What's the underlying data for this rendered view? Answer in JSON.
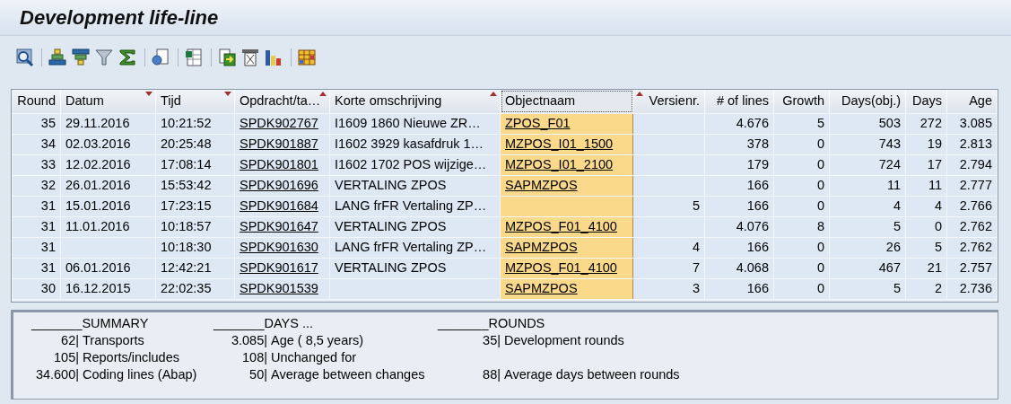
{
  "window": {
    "title": "Development life-line"
  },
  "table": {
    "columns": [
      {
        "label": "Round",
        "numeric": true,
        "sort_down": false,
        "sort_up": false,
        "selected": false
      },
      {
        "label": "Datum",
        "numeric": false,
        "sort_down": true,
        "sort_up": false,
        "selected": false
      },
      {
        "label": "Tijd",
        "numeric": false,
        "sort_down": true,
        "sort_up": false,
        "selected": false
      },
      {
        "label": "Opdracht/ta…",
        "numeric": false,
        "sort_down": false,
        "sort_up": true,
        "selected": false
      },
      {
        "label": "Korte omschrijving",
        "numeric": false,
        "sort_down": false,
        "sort_up": true,
        "selected": false
      },
      {
        "label": "Objectnaam",
        "numeric": false,
        "sort_down": false,
        "sort_up": false,
        "selected": true
      },
      {
        "label": "Versienr.",
        "numeric": true,
        "sort_down": false,
        "sort_up": true,
        "selected": false
      },
      {
        "label": "# of lines",
        "numeric": true,
        "sort_down": false,
        "sort_up": false,
        "selected": false
      },
      {
        "label": "Growth",
        "numeric": true,
        "sort_down": false,
        "sort_up": false,
        "selected": false
      },
      {
        "label": "Days(obj.)",
        "numeric": true,
        "sort_down": false,
        "sort_up": false,
        "selected": false
      },
      {
        "label": "Days",
        "numeric": true,
        "sort_down": false,
        "sort_up": false,
        "selected": false
      },
      {
        "label": "Age",
        "numeric": true,
        "sort_down": false,
        "sort_up": false,
        "selected": false
      }
    ],
    "rows": [
      {
        "round": "35",
        "datum": "29.11.2016",
        "tijd": "10:21:52",
        "opdracht": "SPDK902767",
        "omschrijving": "I1609 1860 Nieuwe ZR…",
        "objectnaam": "ZPOS_F01",
        "lines": "4.676",
        "growth": "5",
        "days_obj": "503",
        "days": "272",
        "age": "3.085"
      },
      {
        "round": "34",
        "datum": "02.03.2016",
        "tijd": "20:25:48",
        "opdracht": "SPDK901887",
        "omschrijving": "I1602 3929 kasafdruk 1…",
        "objectnaam": "MZPOS_I01_1500",
        "lines": "378",
        "growth": "0",
        "days_obj": "743",
        "days": "19",
        "age": "2.813"
      },
      {
        "round": "33",
        "datum": "12.02.2016",
        "tijd": "17:08:14",
        "opdracht": "SPDK901801",
        "omschrijving": "I1602 1702 POS wijzige…",
        "objectnaam": "MZPOS_I01_2100",
        "lines": "179",
        "growth": "0",
        "days_obj": "724",
        "days": "17",
        "age": "2.794"
      },
      {
        "round": "32",
        "datum": "26.01.2016",
        "tijd": "15:53:42",
        "opdracht": "SPDK901696",
        "omschrijving": "VERTALING ZPOS",
        "objectnaam": "SAPMZPOS",
        "lines": "166",
        "growth": "0",
        "days_obj": "11",
        "days": "11",
        "age": "2.777"
      },
      {
        "round": "31",
        "datum": "15.01.2016",
        "tijd": "17:23:15",
        "opdracht": "SPDK901684",
        "omschrijving": "LANG frFR Vertaling ZP…",
        "versienr": "5",
        "lines": "166",
        "growth": "0",
        "days_obj": "4",
        "days": "4",
        "age": "2.766"
      },
      {
        "round": "31",
        "datum": "11.01.2016",
        "tijd": "10:18:57",
        "opdracht": "SPDK901647",
        "omschrijving": "VERTALING ZPOS",
        "objectnaam": "MZPOS_F01_4100",
        "lines": "4.076",
        "growth": "8",
        "days_obj": "5",
        "days": "0",
        "age": "2.762"
      },
      {
        "round": "31",
        "tijd": "10:18:30",
        "opdracht": "SPDK901630",
        "omschrijving": "LANG frFR Vertaling ZP…",
        "objectnaam": "SAPMZPOS",
        "versienr": "4",
        "lines": "166",
        "growth": "0",
        "days_obj": "26",
        "days": "5",
        "age": "2.762"
      },
      {
        "round": "31",
        "datum": "06.01.2016",
        "tijd": "12:42:21",
        "opdracht": "SPDK901617",
        "omschrijving": "VERTALING ZPOS",
        "objectnaam": "MZPOS_F01_4100",
        "versienr": "7",
        "lines": "4.068",
        "growth": "0",
        "days_obj": "467",
        "days": "21",
        "age": "2.757"
      },
      {
        "round": "30",
        "datum": "16.12.2015",
        "tijd": "22:02:35",
        "opdracht": "SPDK901539",
        "objectnaam": "SAPMZPOS",
        "versienr": "3",
        "lines": "166",
        "growth": "0",
        "days_obj": "5",
        "days": "2",
        "age": "2.736"
      }
    ]
  },
  "summary": {
    "sections": [
      {
        "heading": "_______SUMMARY",
        "items": [
          {
            "amount": "62|",
            "caption": "Transports"
          },
          {
            "amount": "105|",
            "caption": "Reports/includes"
          },
          {
            "amount": "34.600|",
            "caption": "Coding lines (Abap)"
          }
        ]
      },
      {
        "heading": "_______DAYS ...",
        "items": [
          {
            "amount": "3.085|",
            "caption": "Age ( 8,5 years)"
          },
          {
            "amount": "108|",
            "caption": "Unchanged for"
          },
          {
            "amount": "50|",
            "caption": "Average between changes"
          }
        ]
      },
      {
        "heading": "_______ROUNDS",
        "items": [
          {
            "amount": "35|",
            "caption": "Development rounds"
          },
          {
            "amount": "88|",
            "caption": "Average days between rounds",
            "after_blank_line": true
          }
        ]
      }
    ]
  }
}
